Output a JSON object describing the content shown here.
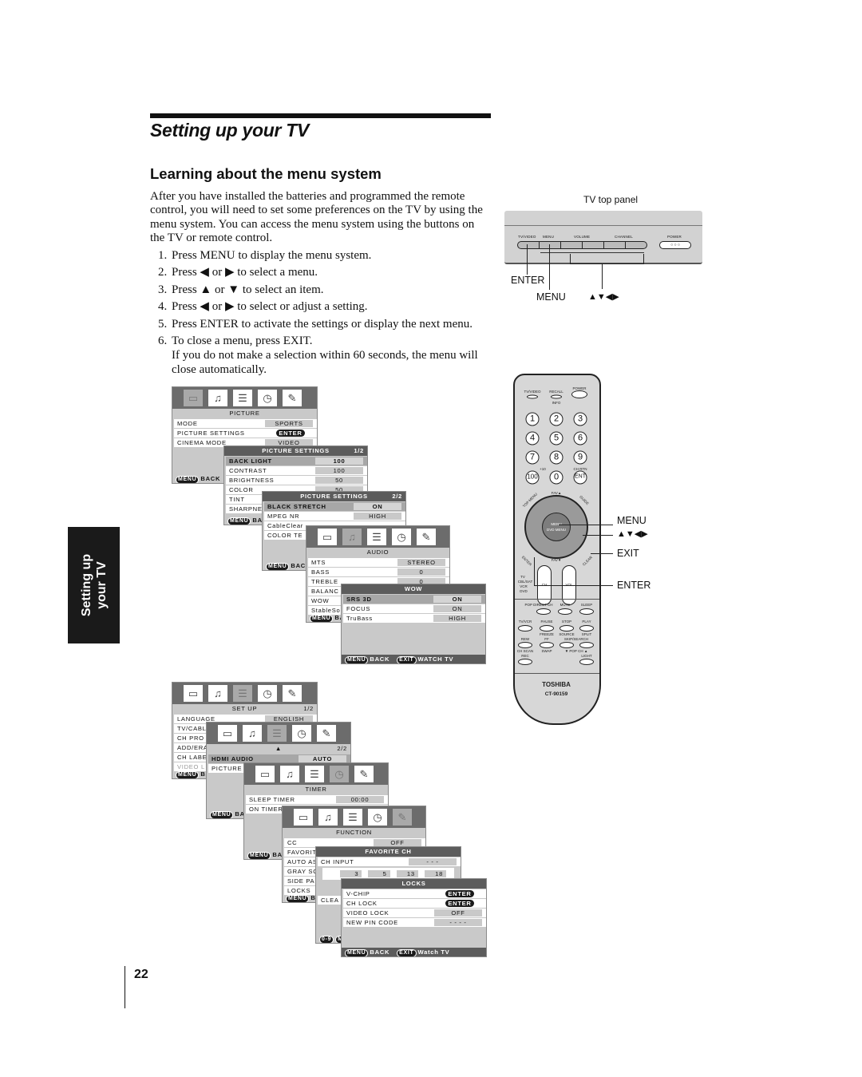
{
  "header": {
    "title": "Setting up your TV",
    "section": "Learning about the menu system"
  },
  "intro": "After you have installed the batteries and programmed the remote control, you will need to set some preferences on the TV by using the menu system. You can access the menu system using the buttons on the TV or remote control.",
  "steps": [
    {
      "n": "1.",
      "text": "Press MENU to display the menu system."
    },
    {
      "n": "2.",
      "text": "Press ◀ or ▶ to select a menu."
    },
    {
      "n": "3.",
      "text": "Press ▲ or ▼ to select an item."
    },
    {
      "n": "4.",
      "text": "Press ◀ or ▶ to select or adjust a setting."
    },
    {
      "n": "5.",
      "text": "Press ENTER to activate the settings or display the next menu."
    },
    {
      "n": "6.",
      "text": "To close a menu, press EXIT."
    }
  ],
  "note": "If you do not make a selection within 60 seconds, the menu will close automatically.",
  "side_tab": {
    "line1": "Setting up",
    "line2": "your TV"
  },
  "page_number": "22",
  "tv_panel": {
    "caption": "TV top panel",
    "labels": [
      "TV/VIDEO",
      "MENU",
      "VOLUME",
      "CHANNEL",
      "POWER"
    ],
    "callouts": {
      "enter": "ENTER",
      "menu": "MENU",
      "arrows": "▲▼◀▶"
    }
  },
  "remote": {
    "top": [
      "TV/VIDEO",
      "RECALL",
      "POWER",
      "INFO"
    ],
    "numbers": [
      "1",
      "2",
      "3",
      "4",
      "5",
      "6",
      "7",
      "8",
      "9",
      "100",
      "0",
      "ENT"
    ],
    "num_labels": [
      "+10",
      "CH RTN"
    ],
    "nav": {
      "fav_up": "FAV▲",
      "fav_down": "FAV▼",
      "menu": "MENU",
      "dvd_menu": "DVD MENU",
      "top_menu": "TOP MENU",
      "guide": "GUIDE",
      "enter": "ENTER",
      "clear": "CLEAR"
    },
    "rockers": [
      "CH",
      "VOL"
    ],
    "modes": [
      "TV",
      "CBL/SAT",
      "VCR",
      "DVD"
    ],
    "row1": [
      "POP DIRECT CH",
      "MUTE",
      "SLEEP"
    ],
    "row2": [
      "TV/VCR",
      "PAUSE",
      "STOP",
      "PLAY"
    ],
    "row2b": [
      "FREEZE",
      "SOURCE",
      "SPLIT"
    ],
    "row3": [
      "REW",
      "FF",
      "SKIP/SEARCH"
    ],
    "row3b": [
      "CH SCAN",
      "SWAP",
      "▼ POP CH ▲"
    ],
    "row4": [
      "REC",
      "LIGHT"
    ],
    "brand": "TOSHIBA",
    "model": "CT-90159",
    "callouts": [
      "MENU",
      "▲▼◀▶",
      "EXIT",
      "ENTER"
    ]
  },
  "menus": [
    {
      "id": "m0",
      "head": "icons",
      "active": 0,
      "title": "PICTURE",
      "page": "",
      "rows": [
        {
          "l": "MODE",
          "v": "SPORTS"
        },
        {
          "l": "PICTURE SETTINGS",
          "v": "ENTER",
          "s": "enter"
        },
        {
          "l": "CINEMA MODE",
          "v": "VIDEO"
        }
      ],
      "foot": [
        {
          "k": "MENU",
          "t": "BACK"
        }
      ]
    },
    {
      "id": "m1",
      "head": "bar",
      "title": "PICTURE SETTINGS",
      "page": "1/2",
      "rows": [
        {
          "l": "BACK LIGHT",
          "v": "100",
          "sel": true
        },
        {
          "l": "CONTRAST",
          "v": "100"
        },
        {
          "l": "BRIGHTNESS",
          "v": "50"
        },
        {
          "l": "COLOR",
          "v": "50"
        },
        {
          "l": "TINT"
        },
        {
          "l": "SHARPNE"
        }
      ],
      "foot": [
        {
          "k": "MENU",
          "t": "BACK"
        }
      ]
    },
    {
      "id": "m2",
      "head": "bar",
      "title": "PICTURE SETTINGS",
      "page": "2/2",
      "rows": [
        {
          "l": "BLACK STRETCH",
          "v": "ON",
          "sel": true
        },
        {
          "l": "MPEG NR",
          "v": "HIGH"
        },
        {
          "l": "CableClear"
        },
        {
          "l": "COLOR TE"
        }
      ],
      "foot": [
        {
          "k": "MENU",
          "t": "BACK"
        }
      ]
    },
    {
      "id": "m3",
      "head": "icons",
      "active": 1,
      "title": "AUDIO",
      "page": "",
      "rows": [
        {
          "l": "MTS",
          "v": "STEREO"
        },
        {
          "l": "BASS",
          "v": "0"
        },
        {
          "l": "TREBLE",
          "v": "0"
        },
        {
          "l": "BALANC"
        },
        {
          "l": "WOW"
        },
        {
          "l": "StableSo"
        }
      ],
      "foot": [
        {
          "k": "MENU",
          "t": "BA"
        }
      ]
    },
    {
      "id": "m4",
      "head": "bar",
      "title": "WOW",
      "page": "",
      "rows": [
        {
          "l": "SRS 3D",
          "v": "ON",
          "sel": true
        },
        {
          "l": "FOCUS",
          "v": "ON"
        },
        {
          "l": "TruBass",
          "v": "HIGH"
        }
      ],
      "foot": [
        {
          "k": "MENU",
          "t": "BACK"
        },
        {
          "k": "EXIT",
          "t": "WATCH TV"
        }
      ],
      "dark": true
    },
    {
      "id": "m5",
      "head": "icons",
      "active": 2,
      "title": "SET UP",
      "page": "1/2",
      "rows": [
        {
          "l": "LANGUAGE",
          "v": "ENGLISH"
        },
        {
          "l": "TV/CABL"
        },
        {
          "l": "CH PRO"
        },
        {
          "l": "ADD/ERA"
        },
        {
          "l": "CH LABE"
        },
        {
          "l": "VIDEO L",
          "dim": true
        }
      ],
      "foot": [
        {
          "k": "MENU",
          "t": "BA"
        }
      ]
    },
    {
      "id": "m6",
      "head": "icons",
      "active": 2,
      "title": "▲",
      "page": "2/2",
      "rows": [
        {
          "l": "HDMI AUDIO",
          "v": "AUTO",
          "sel": true
        },
        {
          "l": "PICTURE"
        }
      ],
      "foot": [
        {
          "k": "MENU",
          "t": "BA"
        }
      ]
    },
    {
      "id": "m7",
      "head": "icons",
      "active": 3,
      "title": "TIMER",
      "page": "",
      "rows": [
        {
          "l": "SLEEP TIMER",
          "v": "00:00"
        },
        {
          "l": "ON TIMER"
        }
      ],
      "foot": [
        {
          "k": "MENU",
          "t": "BA"
        }
      ]
    },
    {
      "id": "m8",
      "head": "icons",
      "active": 4,
      "title": "FUNCTION",
      "page": "",
      "rows": [
        {
          "l": "CC",
          "v": "OFF"
        },
        {
          "l": "FAVORIT"
        },
        {
          "l": "AUTO AS"
        },
        {
          "l": "GRAY SC"
        },
        {
          "l": "SIDE PA"
        },
        {
          "l": "LOCKS"
        }
      ],
      "foot": [
        {
          "k": "MENU",
          "t": "BA"
        }
      ]
    },
    {
      "id": "m9",
      "head": "bar",
      "title": "FAVORITE CH",
      "page": "",
      "rows": [
        {
          "l": "CH INPUT",
          "v": "- - -"
        }
      ],
      "grid": [
        "3",
        "5",
        "13",
        "18"
      ],
      "extra": "CLEA",
      "foot": [
        {
          "k": "0-9",
          "t": ""
        },
        {
          "k": "MENU",
          "t": ""
        }
      ]
    },
    {
      "id": "m10",
      "head": "bar",
      "title": "LOCKS",
      "page": "",
      "rows": [
        {
          "l": "V-CHIP",
          "v": "ENTER",
          "s": "enter"
        },
        {
          "l": "CH LOCK",
          "v": "ENTER",
          "s": "enter"
        },
        {
          "l": "VIDEO LOCK",
          "v": "OFF"
        },
        {
          "l": "NEW PIN CODE",
          "v": "- - - -"
        }
      ],
      "foot": [
        {
          "k": "MENU",
          "t": "BACK"
        },
        {
          "k": "EXIT",
          "t": "Watch TV"
        }
      ],
      "dark": true
    }
  ],
  "menu_icons": [
    "tv-icon",
    "music-note-icon",
    "setup-list-icon",
    "clock-icon",
    "wrench-icon"
  ]
}
